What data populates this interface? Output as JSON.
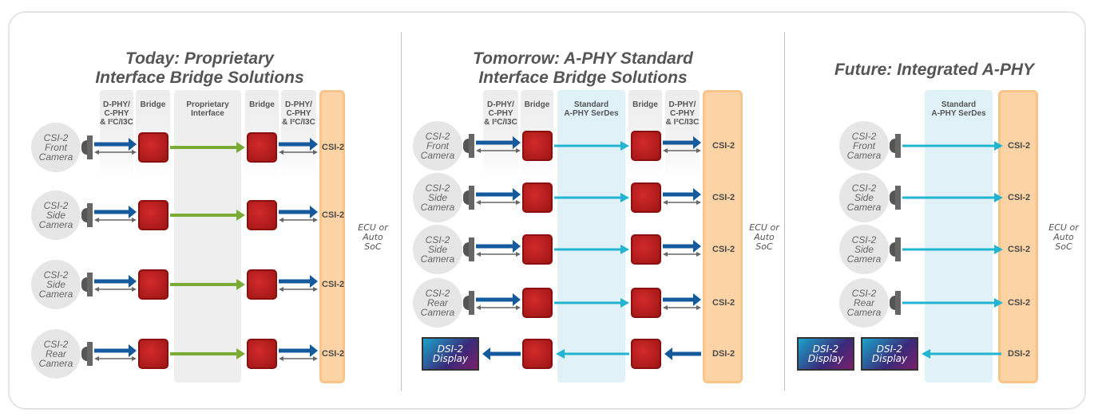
{
  "colors": {
    "camera_link": "#155a9c",
    "proprietary_link": "#7aab35",
    "aphy_link": "#22b5d2",
    "bridge": "#b81c1c",
    "soc": "#fbd3a4",
    "control_link": "#666666"
  },
  "panels": [
    {
      "title": "Today: Proprietary Interface Bridge Solutions",
      "title_lines": [
        "Today: Proprietary",
        "Interface Bridge Solutions"
      ],
      "columns": [
        "D-PHY/ C-PHY & I²C/I3C",
        "Bridge",
        "Proprietary Interface",
        "Bridge",
        "D-PHY/ C-PHY & I²C/I3C"
      ],
      "column_lines": [
        [
          "D-PHY/",
          "C-PHY",
          "& I²C/I3C"
        ],
        [
          "Bridge"
        ],
        [
          "Proprietary",
          "Interface"
        ],
        [
          "Bridge"
        ],
        [
          "D-PHY/",
          "C-PHY",
          "& I²C/I3C"
        ]
      ],
      "cameras": [
        [
          "CSI-2",
          "Front",
          "Camera"
        ],
        [
          "CSI-2",
          "Side",
          "Camera"
        ],
        [
          "CSI-2",
          "Side",
          "Camera"
        ],
        [
          "CSI-2",
          "Rear",
          "Camera"
        ]
      ],
      "soc_ports": [
        "CSI-2",
        "CSI-2",
        "CSI-2",
        "CSI-2"
      ],
      "ecu": [
        "ECU or",
        "Auto",
        "SoC"
      ]
    },
    {
      "title": "Tomorrow: A-PHY Standard Interface Bridge Solutions",
      "title_lines": [
        "Tomorrow: A-PHY Standard",
        "Interface Bridge Solutions"
      ],
      "columns": [
        "D-PHY/ C-PHY & I²C/I3C",
        "Bridge",
        "Standard A-PHY SerDes",
        "Bridge",
        "D-PHY/ C-PHY & I²C/I3C"
      ],
      "column_lines": [
        [
          "D-PHY/",
          "C-PHY",
          "& I²C/I3C"
        ],
        [
          "Bridge"
        ],
        [
          "Standard",
          "A-PHY SerDes"
        ],
        [
          "Bridge"
        ],
        [
          "D-PHY/",
          "C-PHY",
          "& I²C/I3C"
        ]
      ],
      "cameras": [
        [
          "CSI-2",
          "Front",
          "Camera"
        ],
        [
          "CSI-2",
          "Side",
          "Camera"
        ],
        [
          "CSI-2",
          "Side",
          "Camera"
        ],
        [
          "CSI-2",
          "Rear",
          "Camera"
        ]
      ],
      "displays": [
        [
          "DSI-2",
          "Display"
        ]
      ],
      "soc_ports": [
        "CSI-2",
        "CSI-2",
        "CSI-2",
        "CSI-2",
        "DSI-2"
      ],
      "ecu": [
        "ECU or",
        "Auto",
        "SoC"
      ]
    },
    {
      "title": "Future: Integrated A-PHY",
      "title_lines": [
        "Future: Integrated A-PHY"
      ],
      "columns": [
        "Standard A-PHY SerDes"
      ],
      "column_lines": [
        [
          "Standard",
          "A-PHY SerDes"
        ]
      ],
      "cameras": [
        [
          "CSI-2",
          "Front",
          "Camera"
        ],
        [
          "CSI-2",
          "Side",
          "Camera"
        ],
        [
          "CSI-2",
          "Side",
          "Camera"
        ],
        [
          "CSI-2",
          "Rear",
          "Camera"
        ]
      ],
      "displays": [
        [
          "DSI-2",
          "Display"
        ],
        [
          "DSI-2",
          "Display"
        ]
      ],
      "soc_ports": [
        "CSI-2",
        "CSI-2",
        "CSI-2",
        "CSI-2",
        "DSI-2"
      ],
      "ecu": [
        "ECU or",
        "Auto",
        "SoC"
      ]
    }
  ]
}
